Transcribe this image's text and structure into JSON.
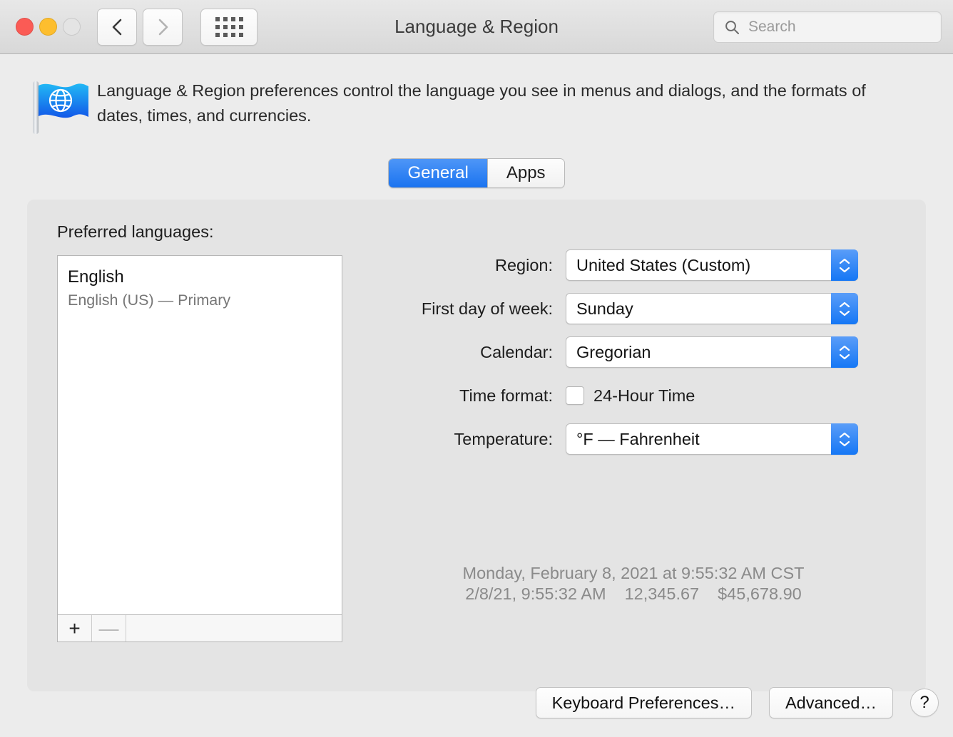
{
  "window": {
    "title": "Language & Region",
    "traffic_lights": [
      "close-button",
      "minimize-button",
      "zoom-button"
    ],
    "nav": {
      "back": "back-icon",
      "forward": "forward-icon",
      "show_all": "grid-icon"
    },
    "search": {
      "placeholder": "Search",
      "value": "",
      "icon": "search-icon"
    }
  },
  "header": {
    "icon": "language-region-flag-icon",
    "description": "Language & Region preferences control the language you see in menus and dialogs, and the formats of dates, times, and currencies."
  },
  "tabs": {
    "items": [
      {
        "label": "General",
        "selected": true
      },
      {
        "label": "Apps",
        "selected": false
      }
    ],
    "selected_accent": "#1a73f0"
  },
  "languages": {
    "label": "Preferred languages:",
    "items": [
      {
        "name": "English",
        "detail": "English (US) — Primary"
      }
    ],
    "toolbar": {
      "add": "+",
      "remove": "—"
    }
  },
  "settings": {
    "region": {
      "label": "Region:",
      "value": "United States (Custom)"
    },
    "first_day": {
      "label": "First day of week:",
      "value": "Sunday"
    },
    "calendar": {
      "label": "Calendar:",
      "value": "Gregorian"
    },
    "time_format": {
      "label": "Time format:",
      "checkbox_label": "24-Hour Time",
      "checked": false
    },
    "temperature": {
      "label": "Temperature:",
      "value": "°F — Fahrenheit"
    }
  },
  "preview": {
    "long_date": "Monday, February 8, 2021 at 9:55:32 AM CST",
    "short_date": "2/8/21, 9:55:32 AM",
    "number": "12,345.67",
    "currency": "$45,678.90"
  },
  "footer": {
    "keyboard_button": "Keyboard Preferences…",
    "advanced_button": "Advanced…",
    "help_button": "?"
  }
}
